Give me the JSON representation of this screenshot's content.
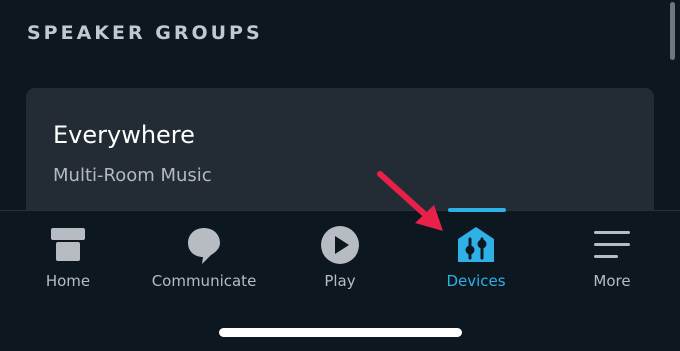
{
  "section": {
    "title": "SPEAKER GROUPS"
  },
  "card": {
    "title": "Everywhere",
    "subtitle": "Multi-Room Music"
  },
  "nav": {
    "tabs": [
      {
        "label": "Home",
        "icon": "home-icon",
        "active": false
      },
      {
        "label": "Communicate",
        "icon": "chat-bubble-icon",
        "active": false
      },
      {
        "label": "Play",
        "icon": "play-icon",
        "active": false
      },
      {
        "label": "Devices",
        "icon": "devices-house-icon",
        "active": true
      },
      {
        "label": "More",
        "icon": "menu-icon",
        "active": false
      }
    ]
  },
  "colors": {
    "background": "#0c1720",
    "card": "#232c35",
    "accent": "#2fb0e7",
    "annotation_arrow": "#e8214b"
  }
}
